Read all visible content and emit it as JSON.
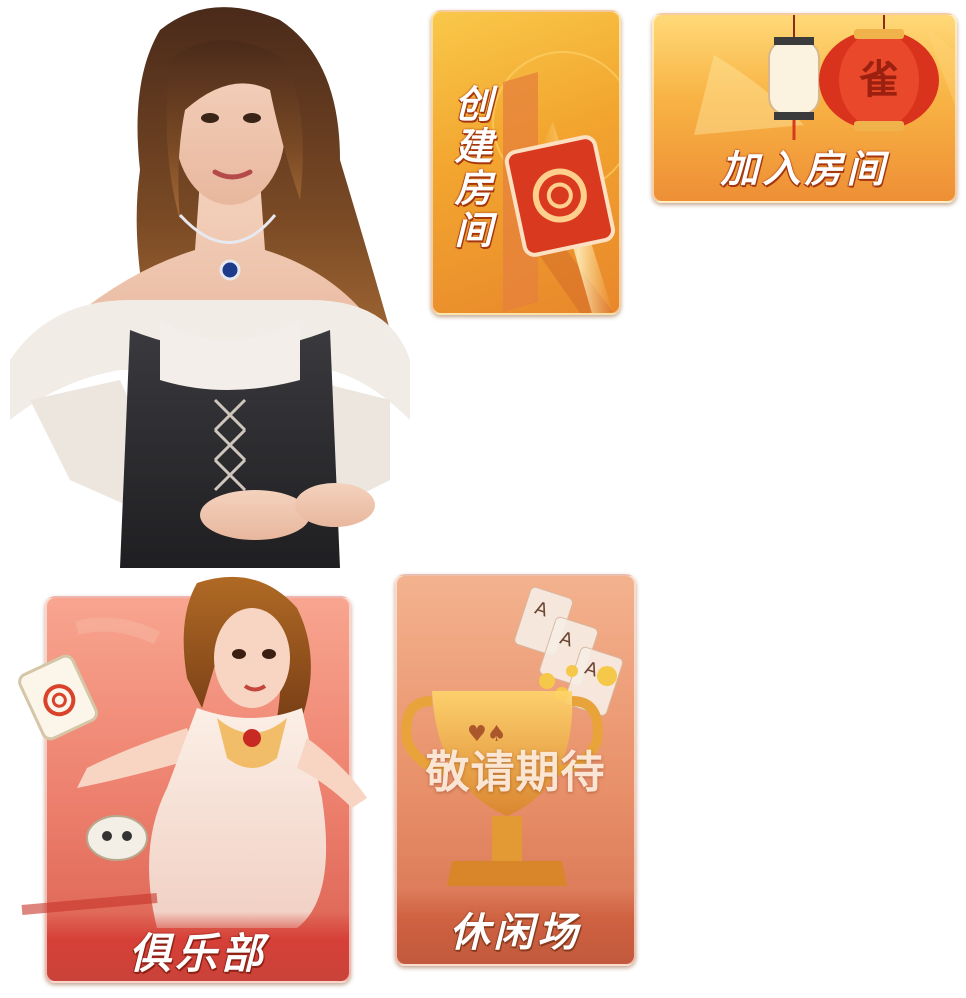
{
  "lobby": {
    "host_character": {
      "icon": "hostess-character"
    },
    "create_room": {
      "label": "创建房间",
      "icon": "mahjong-tile-icon"
    },
    "join_room": {
      "label": "加入房间",
      "icon": "lantern-icon"
    },
    "club": {
      "label": "俱乐部",
      "icon": "mahjong-girl-character"
    },
    "casual": {
      "label": "休闲场",
      "overlay": "敬请期待",
      "icon": "trophy-icon"
    }
  },
  "colors": {
    "create_card": "#f2a52f",
    "join_card": "#f8b344",
    "club_card": "#ec7e6c",
    "casual_card": "#e89069",
    "label_outline": "#a4360e"
  }
}
